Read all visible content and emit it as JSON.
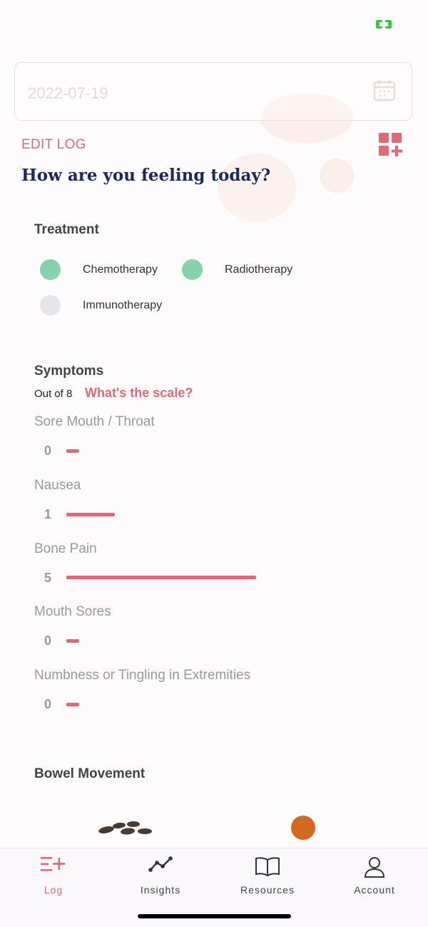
{
  "date_field": {
    "value": "2022-07-19"
  },
  "edit_log_label": "EDIT LOG",
  "headline": "How are you feeling today?",
  "treatment": {
    "title": "Treatment",
    "options": [
      {
        "label": "Chemotherapy",
        "selected": true
      },
      {
        "label": "Radiotherapy",
        "selected": true
      },
      {
        "label": "Immunotherapy",
        "selected": false
      }
    ]
  },
  "symptoms": {
    "title": "Symptoms",
    "out_of": "Out of 8",
    "scale_link": "What's the scale?",
    "max": 8,
    "items": [
      {
        "name": "Sore Mouth / Throat",
        "value": "0"
      },
      {
        "name": "Nausea",
        "value": "1"
      },
      {
        "name": "Bone Pain",
        "value": "5"
      },
      {
        "name": "Mouth Sores",
        "value": "0"
      },
      {
        "name": "Numbness or Tingling in Extremities",
        "value": "0"
      }
    ]
  },
  "bowel": {
    "title": "Bowel Movement"
  },
  "tabs": [
    {
      "label": "Log",
      "icon": "log-add-icon",
      "active": true
    },
    {
      "label": "Insights",
      "icon": "line-chart-icon",
      "active": false
    },
    {
      "label": "Resources",
      "icon": "book-icon",
      "active": false
    },
    {
      "label": "Account",
      "icon": "person-icon",
      "active": false
    }
  ],
  "colors": {
    "accent": "#e06a74",
    "headline": "#1b2a5e",
    "selected": "#86d1ae",
    "unselected": "#e6e6ea",
    "battery": "#2ecc40"
  }
}
